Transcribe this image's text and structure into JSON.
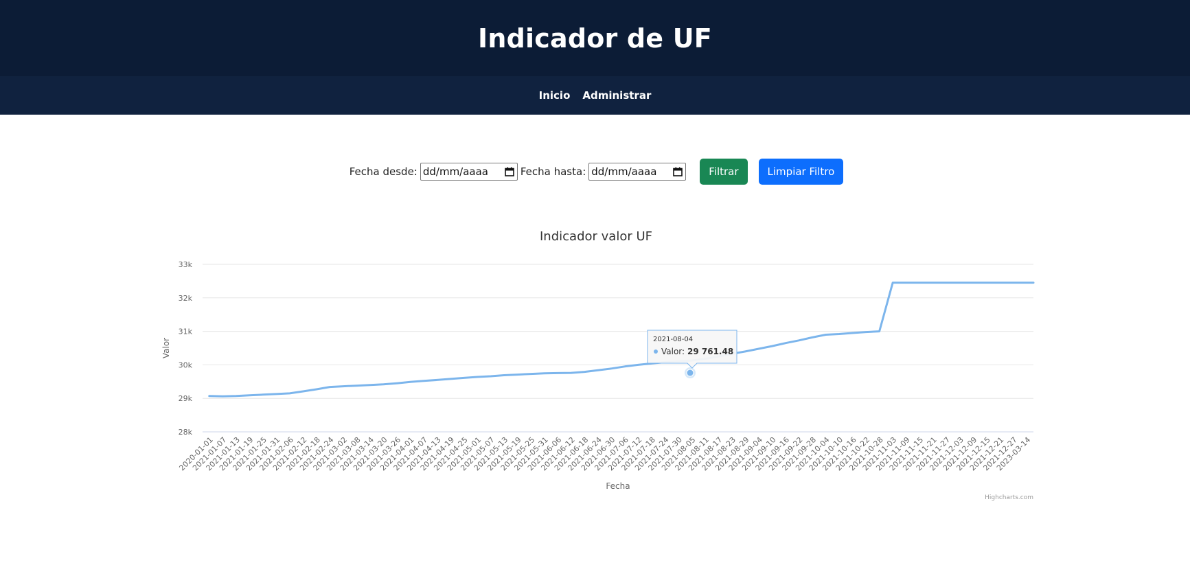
{
  "header": {
    "title": "Indicador de UF"
  },
  "nav": {
    "items": [
      "Inicio",
      "Administrar"
    ]
  },
  "filters": {
    "from_label": "Fecha desde:",
    "from_placeholder": "dd/mm/aaaa",
    "to_label": "Fecha hasta:",
    "to_placeholder": "dd/mm/aaaa",
    "filter_button": "Filtrar",
    "clear_button": "Limpiar Filtro"
  },
  "tooltip": {
    "date": "2021-08-04",
    "series": "Valor",
    "value": "29 761.48"
  },
  "credits": "Highcharts.com",
  "colors": {
    "header_bg": "#0c1c36",
    "nav_bg": "#10223f",
    "series": "#7cb5ec",
    "filter_btn": "#198754",
    "clear_btn": "#0d6efd"
  },
  "chart_data": {
    "type": "line",
    "title": "Indicador valor UF",
    "xlabel": "Fecha",
    "ylabel": "Valor",
    "ylim": [
      28000,
      33000
    ],
    "yticks": [
      "28k",
      "29k",
      "30k",
      "31k",
      "32k",
      "33k"
    ],
    "grid": true,
    "legend": "none",
    "x": [
      "2020-01-01",
      "2021-01-07",
      "2021-01-13",
      "2021-01-19",
      "2021-01-25",
      "2021-01-31",
      "2021-02-06",
      "2021-02-12",
      "2021-02-18",
      "2021-02-24",
      "2021-03-02",
      "2021-03-08",
      "2021-03-14",
      "2021-03-20",
      "2021-03-26",
      "2021-04-01",
      "2021-04-07",
      "2021-04-13",
      "2021-04-19",
      "2021-04-25",
      "2021-05-01",
      "2021-05-07",
      "2021-05-13",
      "2021-05-19",
      "2021-05-25",
      "2021-05-31",
      "2021-06-06",
      "2021-06-12",
      "2021-06-18",
      "2021-06-24",
      "2021-06-30",
      "2021-07-06",
      "2021-07-12",
      "2021-07-18",
      "2021-07-24",
      "2021-07-30",
      "2021-08-05",
      "2021-08-11",
      "2021-08-17",
      "2021-08-23",
      "2021-08-29",
      "2021-09-04",
      "2021-09-10",
      "2021-09-16",
      "2021-09-22",
      "2021-09-28",
      "2021-10-04",
      "2021-10-10",
      "2021-10-16",
      "2021-10-22",
      "2021-10-28",
      "2021-11-03",
      "2021-11-09",
      "2021-11-15",
      "2021-11-21",
      "2021-11-27",
      "2021-12-03",
      "2021-12-09",
      "2021-12-15",
      "2021-12-21",
      "2021-12-27",
      "2023-03-14"
    ],
    "series": [
      {
        "values": [
          29070,
          29060,
          29070,
          29090,
          29110,
          29130,
          29150,
          29210,
          29270,
          29340,
          29360,
          29380,
          29400,
          29420,
          29450,
          29490,
          29520,
          29550,
          29580,
          29610,
          29640,
          29660,
          29690,
          29710,
          29730,
          29745,
          29755,
          29760,
          29790,
          29840,
          29890,
          29950,
          30000,
          30040,
          30080,
          30110,
          30130,
          30180,
          30250,
          30330,
          30400,
          30480,
          30560,
          30650,
          30730,
          30820,
          30900,
          30920,
          30950,
          30980,
          31000,
          32450
        ]
      }
    ],
    "highlight": {
      "x": "2021-08-04",
      "y": 29761.48
    }
  }
}
